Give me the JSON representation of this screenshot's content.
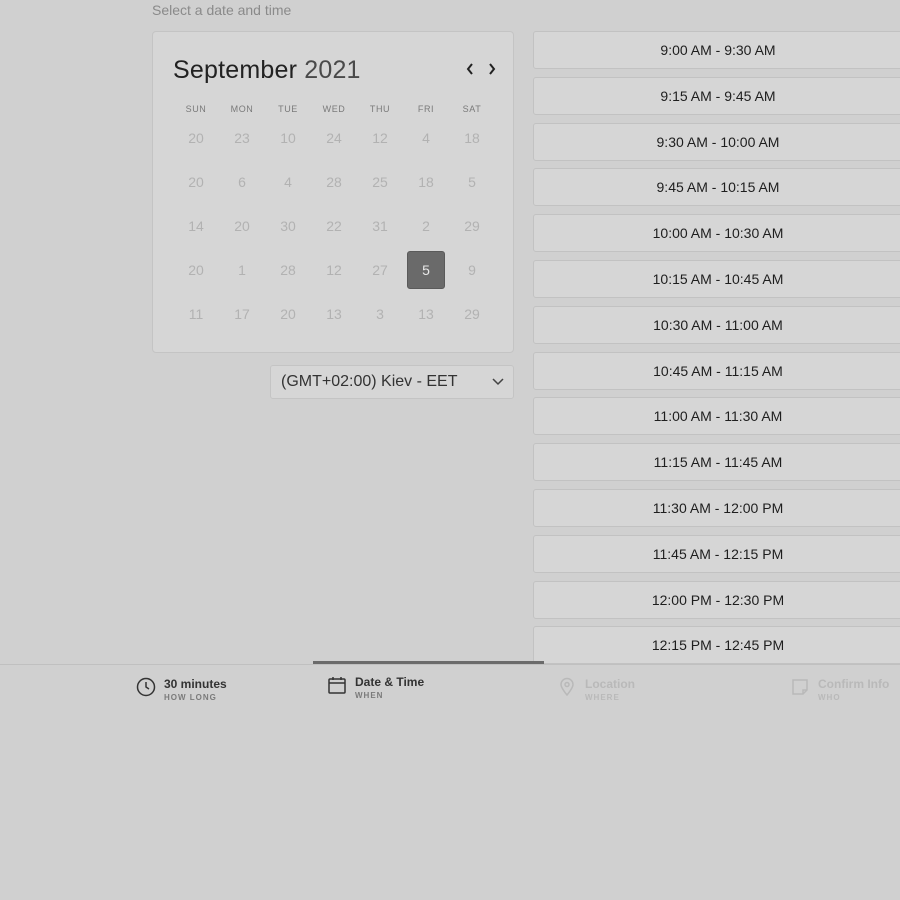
{
  "header": {
    "instruction": "Select a date and time"
  },
  "calendar": {
    "month": "September",
    "year": "2021",
    "weekdays": [
      "SUN",
      "MON",
      "TUE",
      "WED",
      "THU",
      "FRI",
      "SAT"
    ],
    "weeks": [
      [
        "20",
        "23",
        "10",
        "24",
        "12",
        "4",
        "18"
      ],
      [
        "20",
        "6",
        "4",
        "28",
        "25",
        "18",
        "5"
      ],
      [
        "14",
        "20",
        "30",
        "22",
        "31",
        "2",
        "29"
      ],
      [
        "20",
        "1",
        "28",
        "12",
        "27",
        "5",
        "9"
      ],
      [
        "11",
        "17",
        "20",
        "13",
        "3",
        "13",
        "29"
      ]
    ],
    "selected_week": 3,
    "selected_day_index": 5
  },
  "timezone": {
    "value": "(GMT+02:00) Kiev - EET"
  },
  "slots": [
    "9:00 AM - 9:30 AM",
    "9:15 AM - 9:45 AM",
    "9:30 AM - 10:00 AM",
    "9:45 AM - 10:15 AM",
    "10:00 AM - 10:30 AM",
    "10:15 AM - 10:45 AM",
    "10:30 AM - 11:00 AM",
    "10:45 AM - 11:15 AM",
    "11:00 AM - 11:30 AM",
    "11:15 AM - 11:45 AM",
    "11:30 AM - 12:00 PM",
    "11:45 AM - 12:15 PM",
    "12:00 PM - 12:30 PM",
    "12:15 PM - 12:45 PM"
  ],
  "steps": [
    {
      "title": "30 minutes",
      "sub": "HOW LONG",
      "icon": "clock-icon"
    },
    {
      "title": "Date & Time",
      "sub": "WHEN",
      "icon": "calendar-icon"
    },
    {
      "title": "Location",
      "sub": "WHERE",
      "icon": "location-pin-icon"
    },
    {
      "title": "Confirm Info",
      "sub": "WHO",
      "icon": "note-icon"
    }
  ],
  "colors": {
    "background": "#d0d0d0",
    "selected_day": "#6a6a6a",
    "step_indicator": "#6b6b6b"
  }
}
